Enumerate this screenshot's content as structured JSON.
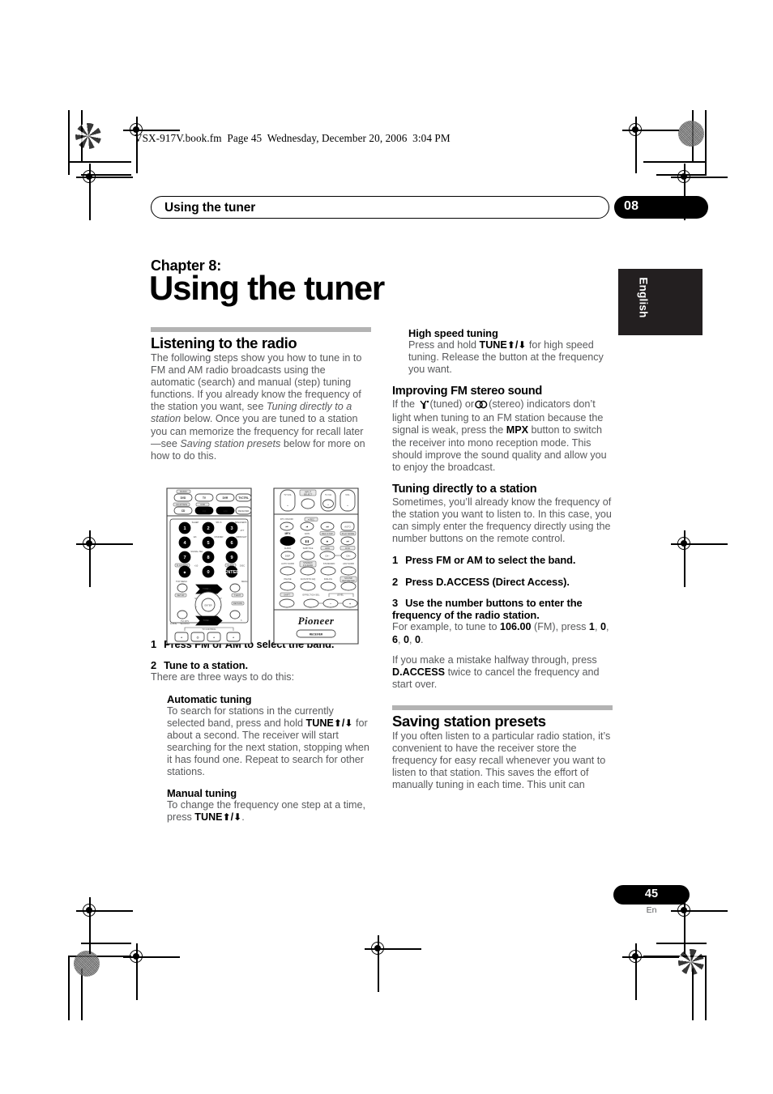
{
  "print_header": "VSX-917V.book.fm  Page 45  Wednesday, December 20, 2006  3:04 PM",
  "running_header": {
    "title": "Using the tuner",
    "chapter_badge": "08"
  },
  "language_tab": "English",
  "chapter": {
    "kicker": "Chapter 8:",
    "title": "Using the tuner"
  },
  "left_column": {
    "section_heading": "Listening to the radio",
    "intro_1": "The following steps show you how to tune in to FM and AM radio broadcasts using the automatic (search) and manual (step) tuning functions. If you already know the frequency of the station you want, see ",
    "intro_italic_1": "Tuning directly to a station",
    "intro_2": " below. Once you are tuned to a station you can memorize the frequency for recall later—see ",
    "intro_italic_2": "Saving station presets",
    "intro_3": " below for more on how to do this.",
    "steps": [
      {
        "num": "1",
        "text": "Press FM or AM to select the band."
      },
      {
        "num": "2",
        "text": "Tune to a station."
      }
    ],
    "step2_follow": "There are three ways to do this:",
    "automatic": {
      "heading": "Automatic tuning",
      "text_a": "To search for stations in the currently selected band, press and hold ",
      "bold_tune": "TUNE",
      "text_b": " for about a second. The receiver will start searching for the next station, stopping when it has found one. Repeat to search for other stations."
    },
    "manual": {
      "heading": "Manual tuning",
      "text_a": "To change the frequency one step at a time, press ",
      "bold_tune": "TUNE",
      "text_b": "."
    }
  },
  "right_column": {
    "high_speed": {
      "heading": "High speed tuning",
      "text_a": "Press and hold ",
      "bold_tune": "TUNE",
      "text_b": " for high speed tuning. Release the button at the frequency you want."
    },
    "improving": {
      "heading": "Improving FM stereo sound",
      "text_a": "If the ",
      "tuned_label": "(tuned) or",
      "stereo_label": "(stereo) indicators don’t light when tuning to an FM station because the signal is weak, press the ",
      "bold_mpx": "MPX",
      "text_b": " button to switch the receiver into mono reception mode. This should improve the sound quality and allow you to enjoy the broadcast."
    },
    "direct": {
      "heading": "Tuning directly to a station",
      "intro": "Sometimes, you’ll already know the frequency of the station you want to listen to. In this case, you can simply enter the frequency directly using the number buttons on the remote control.",
      "steps": [
        {
          "num": "1",
          "text": "Press FM or AM to select the band."
        },
        {
          "num": "2",
          "text": "Press D.ACCESS (Direct Access)."
        },
        {
          "num": "3",
          "text": "Use the number buttons to enter the frequency of the radio station."
        }
      ],
      "example_a": "For example, to tune to ",
      "example_freq": "106.00",
      "example_b": " (FM), press ",
      "example_keys": [
        "1",
        "0",
        "6",
        "0",
        "0"
      ],
      "mistake_a": "If you make a mistake halfway through, press ",
      "mistake_bold": "D.ACCESS",
      "mistake_b": " twice to cancel the frequency and start over."
    },
    "presets": {
      "heading": "Saving station presets",
      "text": "If you often listen to a particular radio station, it’s convenient to have the receiver store the frequency for easy recall whenever you want to listen to that station. This saves the effort of manually tuning in each time. This unit can"
    }
  },
  "remote_figure": {
    "brand": "Pioneer",
    "receiver_label": "RECEIVER",
    "left_remote": {
      "top_labels": [
        "RADIO",
        "CD-R/TAPE",
        "USB"
      ],
      "source_buttons": [
        "DVD",
        "TV",
        "DVR",
        "TVCTRL",
        "CD",
        "FM",
        "AM",
        "RECEIVER"
      ],
      "highlighted": [
        "FM",
        "AM",
        "TUNE +",
        "TUNE -"
      ],
      "micro_labels": [
        "SLEEP",
        "SB ch",
        "SPEAKERS",
        "ATT",
        "DIMMER",
        "MIDNIGHT",
        "EX.",
        "SIGNAL SEL",
        "D.ACCESS",
        "+10",
        "CLASS",
        "DISC",
        "ENTER"
      ],
      "numbers": [
        "1",
        "2",
        "3",
        "4",
        "5",
        "6",
        "7",
        "8",
        "9",
        "0"
      ],
      "nav_labels": [
        "TOP MENU",
        "MENU",
        "ENTER",
        "SETUP",
        "T.EDIT",
        "RETURN",
        "GUIDE",
        "TV/ DTV SEARCH",
        "ST",
        "ST"
      ],
      "tune_up": "TUNE +",
      "tune_down": "TUNE -",
      "tv_control": "TV CONTROL"
    },
    "right_remote": {
      "top_labels": [
        "TV VOL",
        "INPUT SELECT",
        "TV CH",
        "VOL"
      ],
      "rows": [
        [
          "DTV ON/OFF",
          "REC"
        ],
        [
          "MPX",
          "EON",
          "REC STOP",
          "PLAY MODE"
        ],
        [
          "AUDIO",
          "SUBTITLE",
          "HDD",
          "DVD"
        ],
        [
          "DISP",
          "CH-",
          "CH+"
        ],
        [
          "AUTO SURR",
          "STEREO/ F.S.SURR",
          "STANDARD",
          "ADV.SURR"
        ],
        [
          "PHASE",
          "ACOUSTIC EQ",
          "DIALOG",
          "SOUND RETRIEVER"
        ],
        [
          "SHIFT",
          "EFFECT/CH SEL",
          "LEVEL"
        ]
      ],
      "highlighted": [
        "MPX"
      ]
    }
  },
  "footer": {
    "page_number": "45",
    "page_language": "En"
  }
}
